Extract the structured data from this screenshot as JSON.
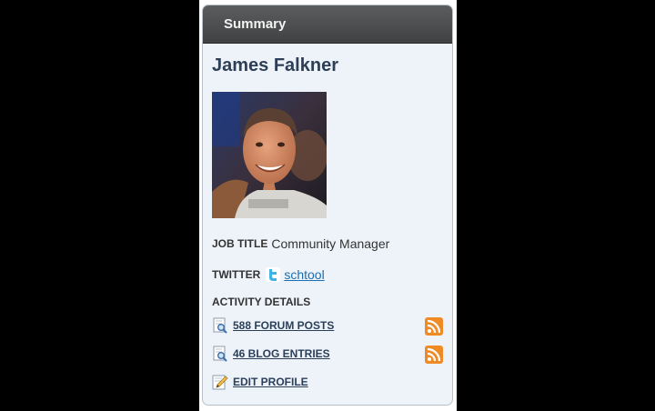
{
  "portlet": {
    "title": "Summary"
  },
  "user": {
    "name": "James Falkner",
    "avatar_icon": "user-portrait"
  },
  "fields": {
    "job_title_label": "JOB TITLE",
    "job_title_value": "Community Manager",
    "twitter_label": "TWITTER",
    "twitter_handle": "schtool",
    "twitter_icon": "twitter-bird-icon"
  },
  "activity": {
    "heading": "ACTIVITY DETAILS",
    "items": [
      {
        "label": "588 FORUM POSTS",
        "icon": "magnifier-document-icon",
        "rss": true
      },
      {
        "label": "46 BLOG ENTRIES",
        "icon": "magnifier-document-icon",
        "rss": true
      },
      {
        "label": "EDIT PROFILE",
        "icon": "pencil-document-icon",
        "rss": false
      }
    ]
  },
  "colors": {
    "header_bg": "#4a4c4d",
    "panel_bg": "#eef3f9",
    "name_color": "#2c3f56",
    "link_color": "#1a6eb3",
    "rss_orange": "#f08a24"
  }
}
